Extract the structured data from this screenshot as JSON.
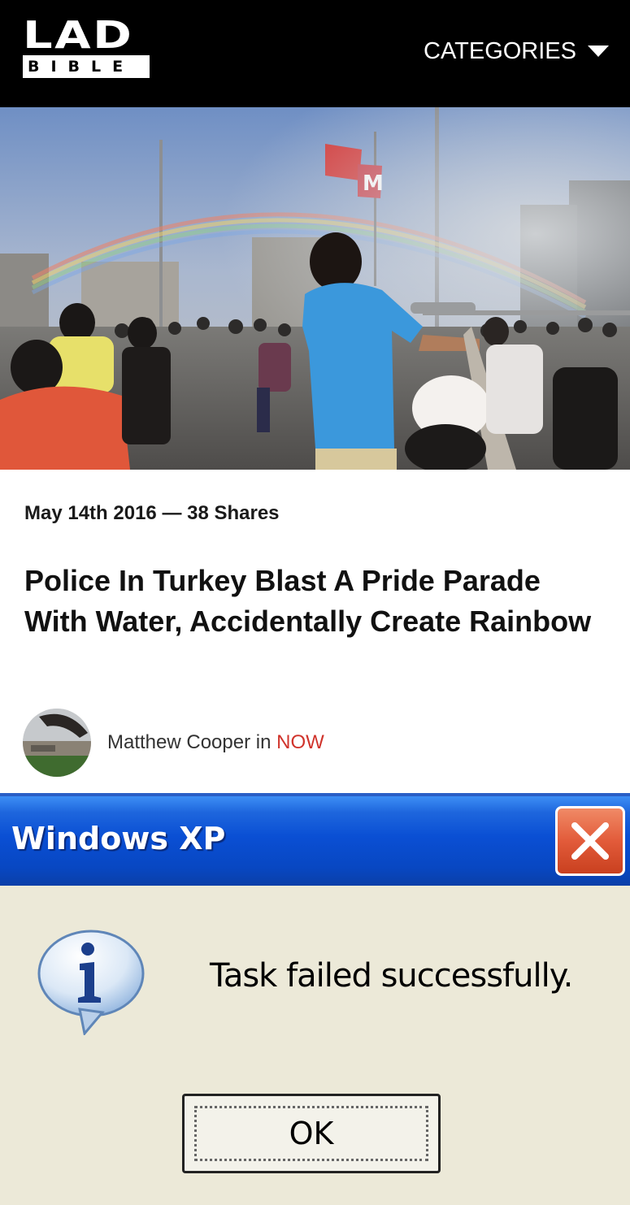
{
  "header": {
    "logo_top": "LAD",
    "logo_bottom": "BIBLE",
    "categories_label": "CATEGORIES",
    "background": "#000000"
  },
  "article": {
    "date": "May 14th 2016",
    "separator": "—",
    "shares": "38 Shares",
    "title": "Police In Turkey Blast A Pride Parade With Water, Accidentally Create Rainbow",
    "author": "Matthew Cooper",
    "in_word": "in",
    "category": "NOW",
    "category_color": "#d0342c"
  },
  "dialog": {
    "title": "Windows XP",
    "message": "Task failed successfully.",
    "ok_label": "OK",
    "titlebar_color": "#0a4fd4",
    "body_color": "#ece9d8",
    "close_icon": "close-icon",
    "info_icon": "info-icon"
  }
}
